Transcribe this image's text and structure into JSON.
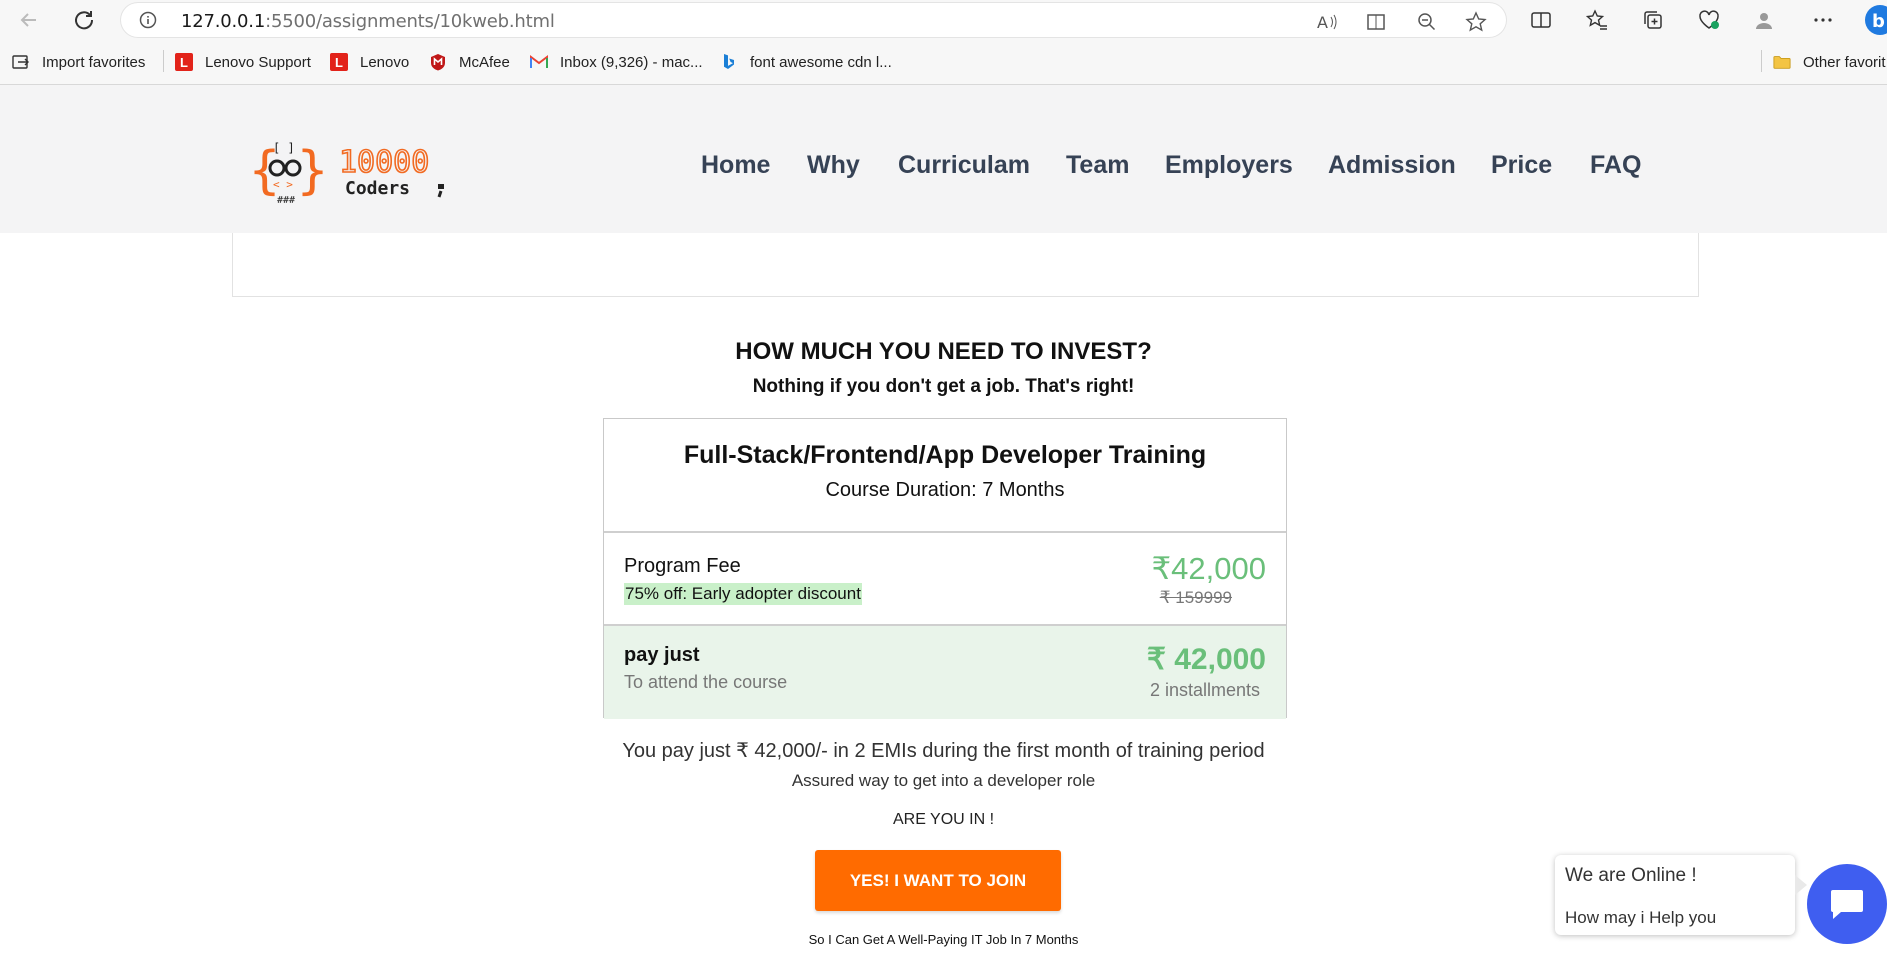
{
  "browser": {
    "url_host": "127.0.0.1",
    "url_rest": ":5500/assignments/10kweb.html"
  },
  "bookmarks": {
    "items": [
      {
        "label": "Import favorites",
        "icon": "import-icon"
      },
      {
        "label": "Lenovo Support",
        "icon": "lenovo-icon"
      },
      {
        "label": "Lenovo",
        "icon": "lenovo-icon"
      },
      {
        "label": "McAfee",
        "icon": "mcafee-icon"
      },
      {
        "label": "Inbox (9,326) - mac...",
        "icon": "gmail-icon"
      },
      {
        "label": "font awesome cdn l...",
        "icon": "bing-icon"
      }
    ],
    "other": "Other favorit"
  },
  "site": {
    "logo_text_top": "10000",
    "logo_text_bottom": "Coders",
    "menu": [
      "Home",
      "Why",
      "Curriculam",
      "Team",
      "Employers",
      "Admission",
      "Price",
      "FAQ"
    ]
  },
  "pricing": {
    "heading": "HOW MUCH YOU NEED TO INVEST?",
    "subheading": "Nothing if you don't get a job. That's right!",
    "title": "Full-Stack/Frontend/App Developer Training",
    "duration": "Course Duration: 7 Months",
    "fee_label": "Program Fee",
    "fee_discount": "75% off: Early adopter discount",
    "fee_price": "₹42,000",
    "fee_old": "₹ 159999",
    "pay_label": "pay just",
    "pay_sub": "To attend the course",
    "pay_price": "₹ 42,000",
    "pay_installments": "2 installments",
    "emi_text": "You pay just ₹ 42,000/- in 2 EMIs during the first month of training period",
    "assured": "Assured way to get into a developer role",
    "are_you_in": "ARE YOU IN !",
    "join_button": "YES! I WANT TO JOIN",
    "tagline": "So I Can Get A Well-Paying IT Job In 7 Months"
  },
  "chat": {
    "line1": "We are Online !",
    "line2": "How may i Help you"
  },
  "colors": {
    "accent_orange": "#ff6b00",
    "price_green": "#6abf7a",
    "nav_text": "#364255",
    "chat_blue": "#3f5ef0"
  }
}
